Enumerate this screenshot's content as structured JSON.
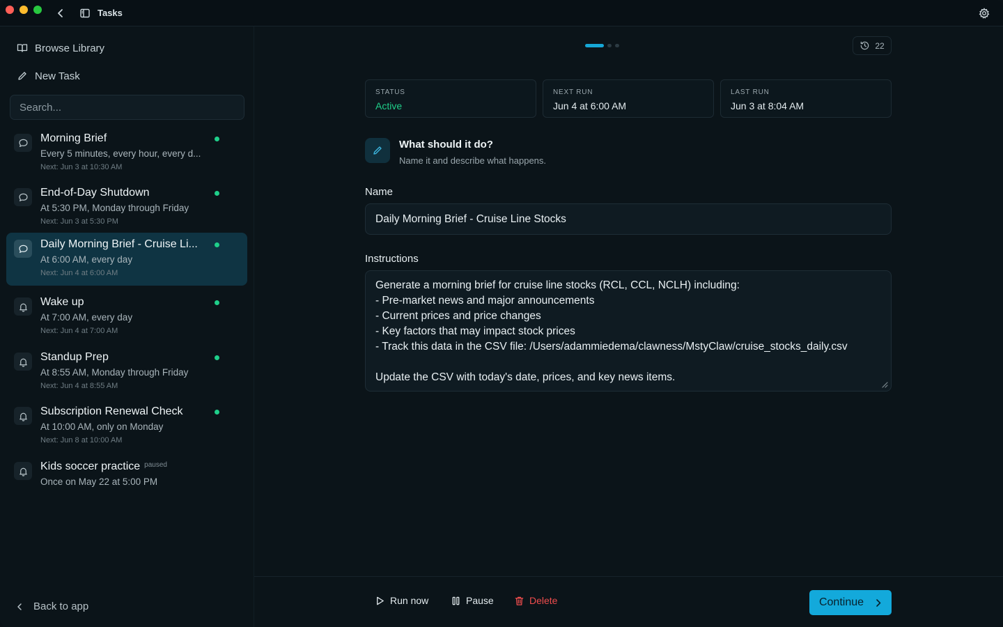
{
  "window": {
    "title": "Tasks"
  },
  "sidebar": {
    "browse_label": "Browse Library",
    "new_task_label": "New Task",
    "search_placeholder": "Search...",
    "back_label": "Back to app",
    "tasks": [
      {
        "title": "Morning Brief",
        "schedule": "Every 5 minutes, every hour, every d...",
        "next": "Next: Jun 3 at 10:30 AM",
        "icon": "chat-bubble-icon",
        "status": "active",
        "selected": false
      },
      {
        "title": "End-of-Day Shutdown",
        "schedule": "At 5:30 PM, Monday through Friday",
        "next": "Next: Jun 3 at 5:30 PM",
        "icon": "chat-bubble-icon",
        "status": "active",
        "selected": false
      },
      {
        "title": "Daily Morning Brief - Cruise Li...",
        "schedule": "At 6:00 AM, every day",
        "next": "Next: Jun 4 at 6:00 AM",
        "icon": "chat-bubble-icon",
        "status": "active",
        "selected": true
      },
      {
        "title": "Wake up",
        "schedule": "At 7:00 AM, every day",
        "next": "Next: Jun 4 at 7:00 AM",
        "icon": "bell-icon",
        "status": "active",
        "selected": false
      },
      {
        "title": "Standup Prep",
        "schedule": "At 8:55 AM, Monday through Friday",
        "next": "Next: Jun 4 at 8:55 AM",
        "icon": "bell-icon",
        "status": "active",
        "selected": false
      },
      {
        "title": "Subscription Renewal Check",
        "schedule": "At 10:00 AM, only on Monday",
        "next": "Next: Jun 8 at 10:00 AM",
        "icon": "bell-icon",
        "status": "active",
        "selected": false
      },
      {
        "title": "Kids soccer practice",
        "badge": "paused",
        "schedule": "Once on May 22 at 5:00 PM",
        "icon": "bell-icon",
        "status": "paused",
        "selected": false
      }
    ]
  },
  "main": {
    "stepper": {
      "total": 3,
      "current": 1
    },
    "history_count": "22",
    "stats": [
      {
        "label": "STATUS",
        "value": "Active"
      },
      {
        "label": "NEXT RUN",
        "value": "Jun 4 at 6:00 AM"
      },
      {
        "label": "LAST RUN",
        "value": "Jun 3 at 8:04 AM"
      }
    ],
    "question": {
      "title": "What should it do?",
      "subtitle": "Name it and describe what happens."
    },
    "name_label": "Name",
    "name_value": "Daily Morning Brief - Cruise Line Stocks",
    "instructions_label": "Instructions",
    "instructions_value": "Generate a morning brief for cruise line stocks (RCL, CCL, NCLH) including:\n- Pre-market news and major announcements\n- Current prices and price changes\n- Key factors that may impact stock prices\n- Track this data in the CSV file: /Users/adammiedema/clawness/MstyClaw/cruise_stocks_daily.csv\n\nUpdate the CSV with today's date, prices, and key news items.",
    "footer": {
      "run_now": "Run now",
      "pause": "Pause",
      "delete": "Delete",
      "continue": "Continue"
    }
  },
  "colors": {
    "accent": "#13a9db",
    "active_green": "#1fcf8a",
    "danger": "#ef4d4d",
    "selected_bg": "#0f3443"
  }
}
